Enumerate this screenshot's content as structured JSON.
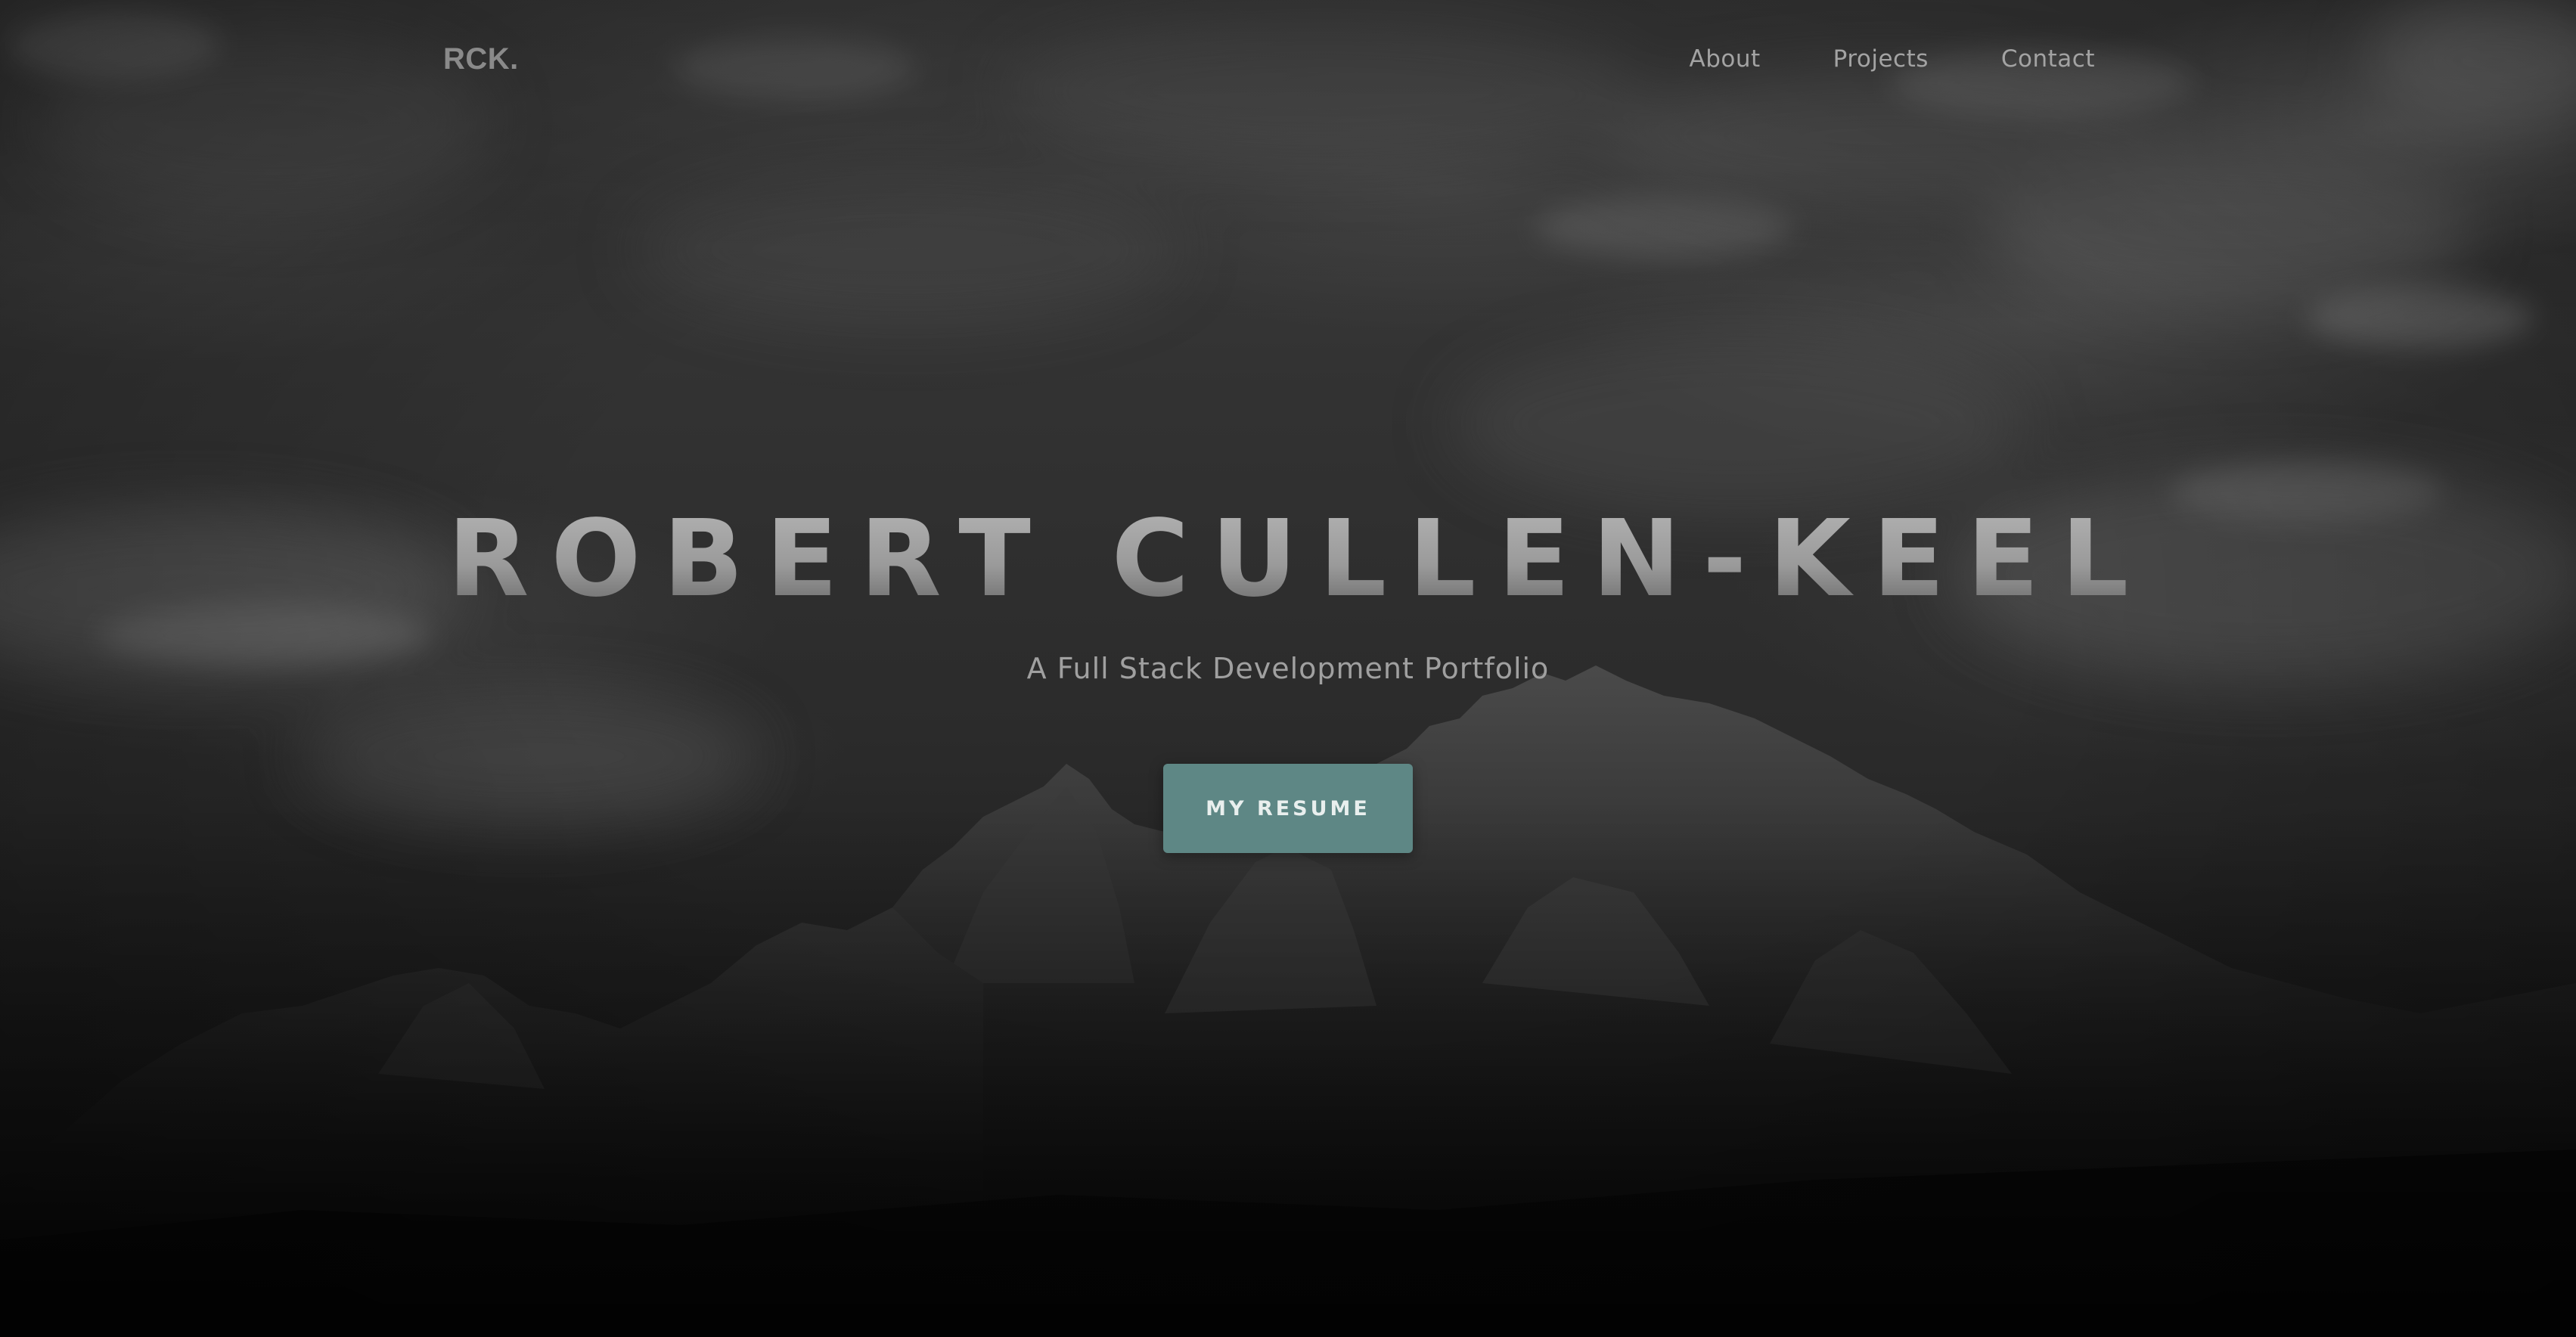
{
  "nav": {
    "logo": "RCK.",
    "links": [
      {
        "label": "About"
      },
      {
        "label": "Projects"
      },
      {
        "label": "Contact"
      }
    ]
  },
  "hero": {
    "title": "ROBERT CULLEN-KEEL",
    "subtitle": "A Full Stack Development Portfolio",
    "cta_label": "MY RESUME"
  },
  "colors": {
    "accent": "#5e8785",
    "background": "#2b2b2b"
  }
}
